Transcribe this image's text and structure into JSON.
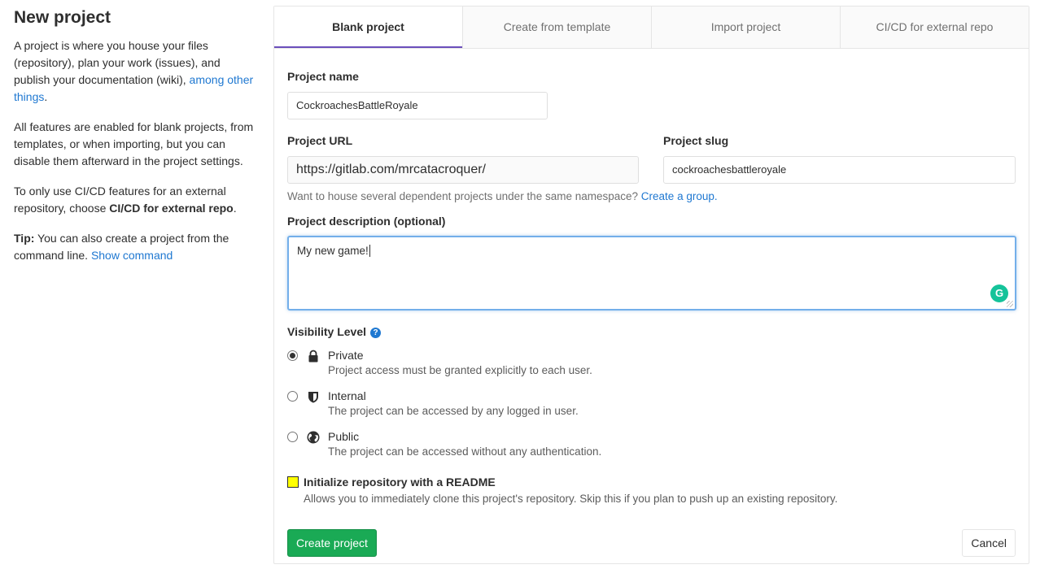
{
  "sidebar": {
    "title": "New project",
    "intro_text": "A project is where you house your files (repository), plan your work (issues), and publish your documentation (wiki),",
    "intro_link": "among other things",
    "intro_end": ".",
    "features_text": "All features are enabled for blank projects, from templates, or when importing, but you can disable them afterward in the project settings.",
    "cicd_text": "To only use CI/CD features for an external repository, choose",
    "cicd_bold": "CI/CD for external repo",
    "cicd_end": ".",
    "tip_bold": "Tip:",
    "tip_text": "You can also create a project from the command line.",
    "tip_link": "Show command"
  },
  "tabs": [
    {
      "label": "Blank project",
      "active": true
    },
    {
      "label": "Create from template",
      "active": false
    },
    {
      "label": "Import project",
      "active": false
    },
    {
      "label": "CI/CD for external repo",
      "active": false
    }
  ],
  "form": {
    "project_name_label": "Project name",
    "project_name_value": "CockroachesBattleRoyale",
    "project_url_label": "Project URL",
    "project_url_value": "https://gitlab.com/mrcatacroquer/",
    "project_slug_label": "Project slug",
    "project_slug_value": "cockroachesbattleroyale",
    "namespace_help": "Want to house several dependent projects under the same namespace?",
    "namespace_link": "Create a group.",
    "description_label": "Project description (optional)",
    "description_value": "My new game!",
    "grammarly_glyph": "G",
    "visibility_label": "Visibility Level",
    "visibility_help_glyph": "?",
    "visibility": [
      {
        "title": "Private",
        "desc": "Project access must be granted explicitly to each user.",
        "icon": "lock-icon",
        "checked": true
      },
      {
        "title": "Internal",
        "desc": "The project can be accessed by any logged in user.",
        "icon": "shield-icon",
        "checked": false
      },
      {
        "title": "Public",
        "desc": "The project can be accessed without any authentication.",
        "icon": "globe-icon",
        "checked": false
      }
    ],
    "readme_label": "Initialize repository with a README",
    "readme_desc": "Allows you to immediately clone this project's repository. Skip this if you plan to push up an existing repository.",
    "create_button": "Create project",
    "cancel_button": "Cancel"
  },
  "colors": {
    "link": "#1f78d1",
    "active_tab_underline": "#6b4fbb",
    "create_button": "#1aaa55",
    "focus_border": "#73afea",
    "highlight": "#ffff00"
  }
}
